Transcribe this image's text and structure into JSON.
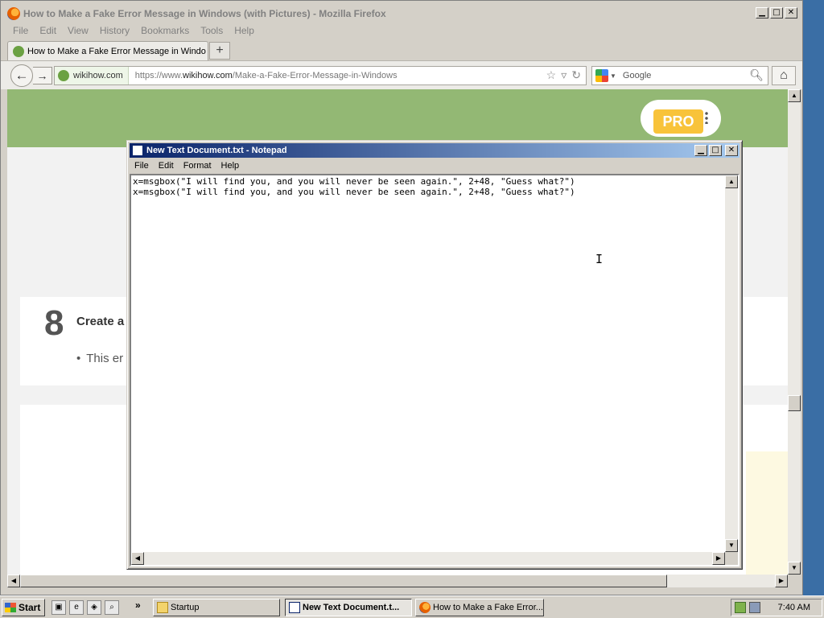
{
  "firefox": {
    "window_title": "How to Make a Fake Error Message in Windows (with Pictures) - Mozilla Firefox",
    "menu": [
      "File",
      "Edit",
      "View",
      "History",
      "Bookmarks",
      "Tools",
      "Help"
    ],
    "tab_label": "How to Make a Fake Error Message in Windo...",
    "new_tab_label": "+",
    "url_domain": "wikihow.com",
    "url_prefix": "https://www.",
    "url_host": "wikihow.com",
    "url_path": "/Make-a-Fake-Error-Message-in-Windows",
    "search_placeholder": "Google"
  },
  "page": {
    "pro_label": "PRO",
    "step_number": "8",
    "step_title": "Create a",
    "step_bullet": "This er"
  },
  "notepad": {
    "title": "New Text Document.txt - Notepad",
    "menu": [
      "File",
      "Edit",
      "Format",
      "Help"
    ],
    "lines": [
      "x=msgbox(\"I will find you, and you will never be seen again.\", 2+48, \"Guess what?\")",
      "x=msgbox(\"I will find you, and you will never be seen again.\", 2+48, \"Guess what?\")"
    ]
  },
  "taskbar": {
    "start_label": "Start",
    "more_label": "»",
    "tasks": [
      "Startup",
      "New Text Document.t...",
      "How to Make a Fake Error..."
    ],
    "clock": "7:40 AM"
  },
  "colors": {
    "wikihow_green": "#93b874",
    "pro_yellow": "#f8c33a",
    "title_active_start": "#0a246a",
    "title_active_end": "#a6caf0"
  }
}
